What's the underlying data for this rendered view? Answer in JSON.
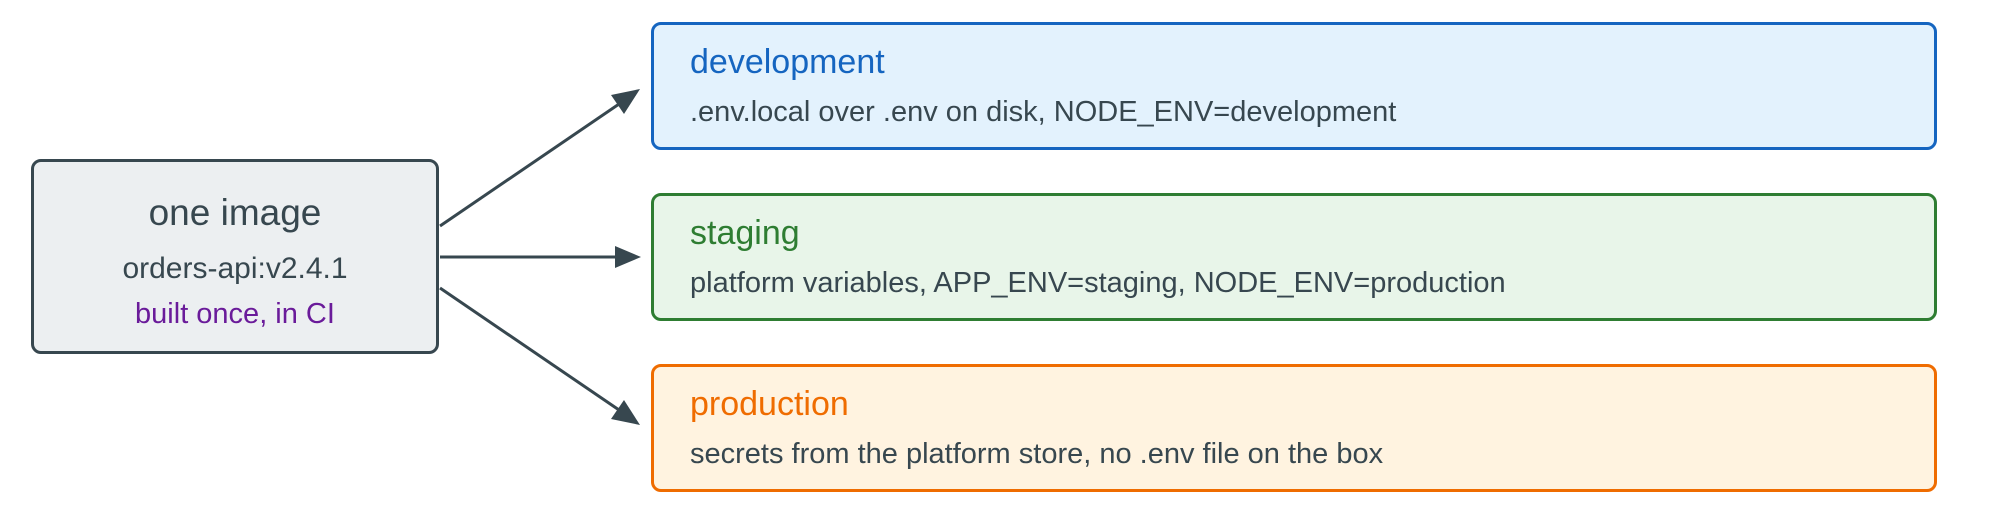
{
  "source": {
    "title": "one image",
    "tag": "orders-api:v2.4.1",
    "note": "built once, in CI"
  },
  "environments": [
    {
      "name": "development",
      "description": ".env.local over .env on disk, NODE_ENV=development",
      "color": "#1565c0"
    },
    {
      "name": "staging",
      "description": "platform variables, APP_ENV=staging, NODE_ENV=production",
      "color": "#2e7d32"
    },
    {
      "name": "production",
      "description": "secrets from the platform store, no .env file on the box",
      "color": "#ef6c00"
    }
  ],
  "colors": {
    "arrow": "#37474f",
    "source_border": "#37474f",
    "source_fill": "#eceff1",
    "note_text": "#6a1b9a"
  }
}
